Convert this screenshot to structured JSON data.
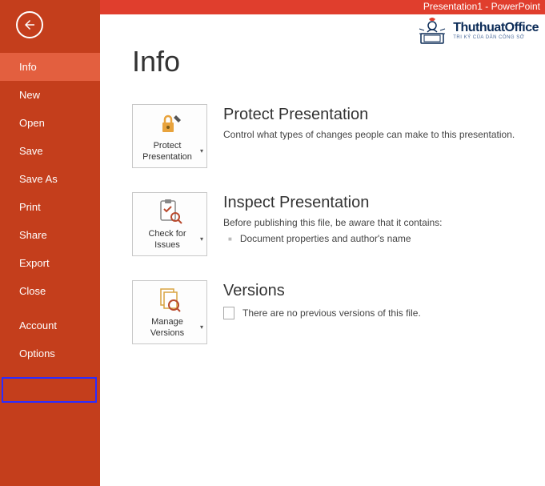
{
  "titlebar": {
    "text": "Presentation1 -  PowerPoint"
  },
  "watermark": {
    "title": "ThuthuatOffice",
    "sub": "TRI KỶ CỦA DÂN CÔNG SỞ"
  },
  "sidebar": {
    "items": [
      {
        "label": "Info",
        "active": true
      },
      {
        "label": "New"
      },
      {
        "label": "Open"
      },
      {
        "label": "Save"
      },
      {
        "label": "Save As"
      },
      {
        "label": "Print"
      },
      {
        "label": "Share"
      },
      {
        "label": "Export"
      },
      {
        "label": "Close"
      },
      {
        "label": "Account"
      },
      {
        "label": "Options",
        "highlighted": true
      }
    ]
  },
  "page": {
    "title": "Info"
  },
  "sections": {
    "protect": {
      "tile_label": "Protect Presentation",
      "title": "Protect Presentation",
      "desc": "Control what types of changes people can make to this presentation."
    },
    "inspect": {
      "tile_label": "Check for Issues",
      "title": "Inspect Presentation",
      "desc": "Before publishing this file, be aware that it contains:",
      "bullet": "Document properties and author's name"
    },
    "versions": {
      "tile_label": "Manage Versions",
      "title": "Versions",
      "desc": "There are no previous versions of this file."
    }
  }
}
